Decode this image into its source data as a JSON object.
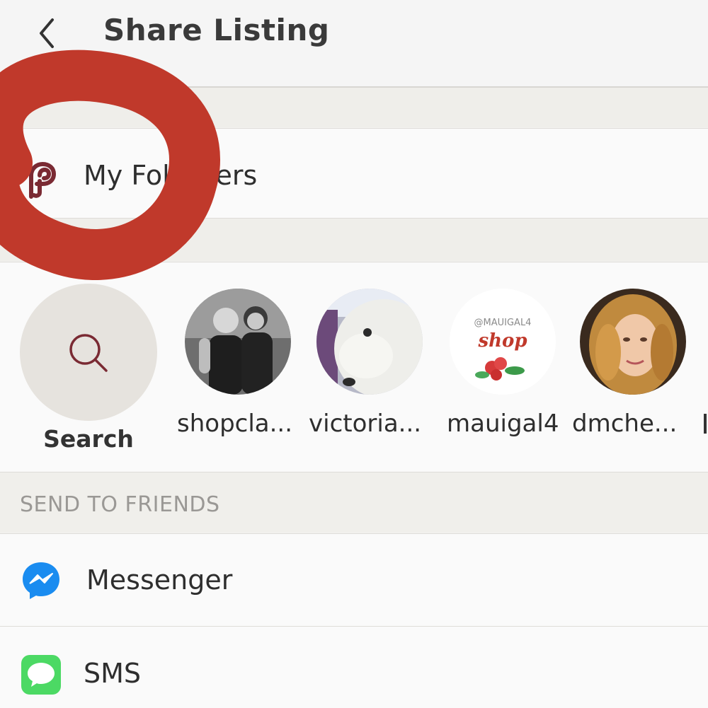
{
  "header": {
    "title": "Share Listing",
    "back_icon": "chevron-left-icon"
  },
  "followers": {
    "label": "My Followers",
    "icon": "poshmark-icon"
  },
  "friends_strip": {
    "search_label": "Search",
    "search_icon": "search-icon",
    "friends": [
      {
        "name": "shopcla..."
      },
      {
        "name": "victoria..."
      },
      {
        "name": "mauigal4",
        "avatar_text_top": "@MAUIGAL4",
        "avatar_text_main": "shop"
      },
      {
        "name": "dmche..."
      }
    ]
  },
  "send_to_friends": {
    "header": "SEND TO FRIENDS",
    "apps": [
      {
        "label": "Messenger",
        "icon": "messenger-icon"
      },
      {
        "label": "SMS",
        "icon": "sms-icon"
      }
    ]
  },
  "colors": {
    "accent": "#7a2a33",
    "annotation_red": "#c0392b",
    "messenger_blue": "#1a8cf0",
    "sms_green": "#4cd964"
  }
}
